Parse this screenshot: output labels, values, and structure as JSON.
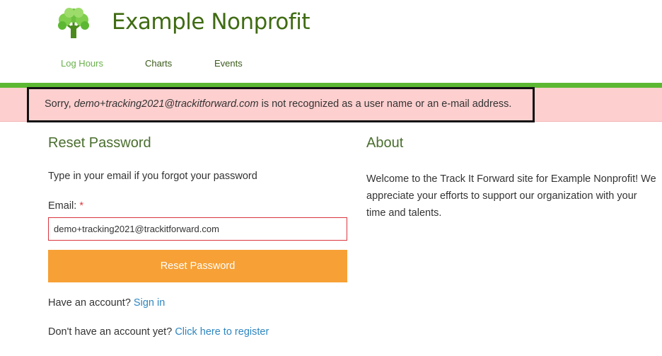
{
  "header": {
    "site_name": "Example Nonprofit",
    "logo_icon": "tree-icon",
    "accent_color": "#5cb832"
  },
  "nav": {
    "items": [
      {
        "label": "Log Hours",
        "active": true
      },
      {
        "label": "Charts",
        "active": false
      },
      {
        "label": "Events",
        "active": false
      }
    ]
  },
  "error": {
    "prefix": "Sorry, ",
    "email": "demo+tracking2021@trackitforward.com",
    "suffix": " is not recognized as a user name or an e-mail address.",
    "background": "#fecfcf"
  },
  "reset_form": {
    "title": "Reset Password",
    "intro": "Type in your email if you forgot your password",
    "email_label": "Email:",
    "required_marker": "*",
    "email_value": "demo+tracking2021@trackitforward.com",
    "submit_label": "Reset Password",
    "button_color": "#f7a035",
    "have_account_text": "Have an account?",
    "sign_in_link": "Sign in",
    "no_account_text": "Don't have an account yet?",
    "register_link": "Click here to register"
  },
  "about": {
    "title": "About",
    "text": "Welcome to the Track It Forward site for Example Nonprofit! We appreciate your efforts to support our organization with your time and talents."
  }
}
